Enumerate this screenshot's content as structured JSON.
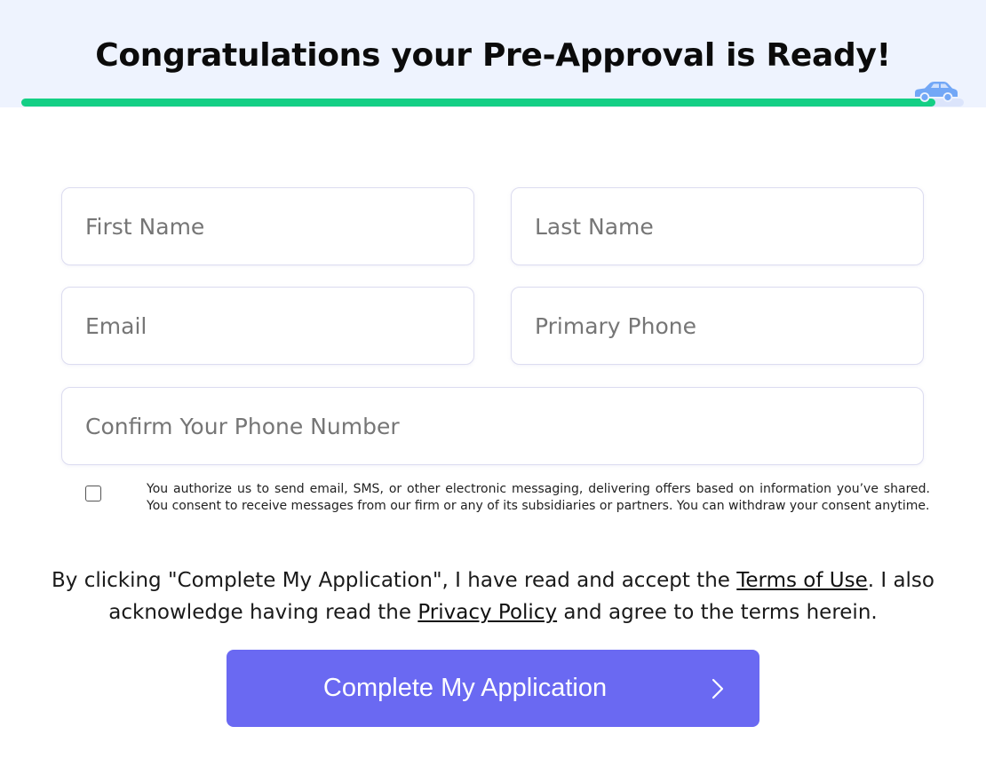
{
  "header": {
    "title": "Congratulations your Pre-Approval is Ready!",
    "progress": 0.97,
    "progress_icon": "car-icon",
    "colors": {
      "band": "#eef3fe",
      "track": "#dbe4fb",
      "fill": "#14cf85",
      "car": "#72a7f6"
    }
  },
  "form": {
    "first_name": {
      "placeholder": "First Name",
      "value": ""
    },
    "last_name": {
      "placeholder": "Last Name",
      "value": ""
    },
    "email": {
      "placeholder": "Email",
      "value": ""
    },
    "primary_phone": {
      "placeholder": "Primary Phone",
      "value": ""
    },
    "confirm_phone": {
      "placeholder": "Confirm Your Phone Number",
      "value": ""
    }
  },
  "consent": {
    "checked": false,
    "text": "You authorize us to send email, SMS, or other electronic messaging, delivering offers based on information you’ve shared. You consent to receive messages from our firm or any of its subsidiaries or partners. You can withdraw your consent anytime."
  },
  "terms": {
    "prefix": "By clicking \"Complete My Application\", I have read and accept the ",
    "terms_link": "Terms of Use",
    "middle": ". I also acknowledge having read the ",
    "privacy_link": "Privacy Policy",
    "suffix": " and agree to the terms herein."
  },
  "submit": {
    "label": "Complete My Application",
    "icon": "chevron-right-icon",
    "color": "#6a69f2"
  }
}
